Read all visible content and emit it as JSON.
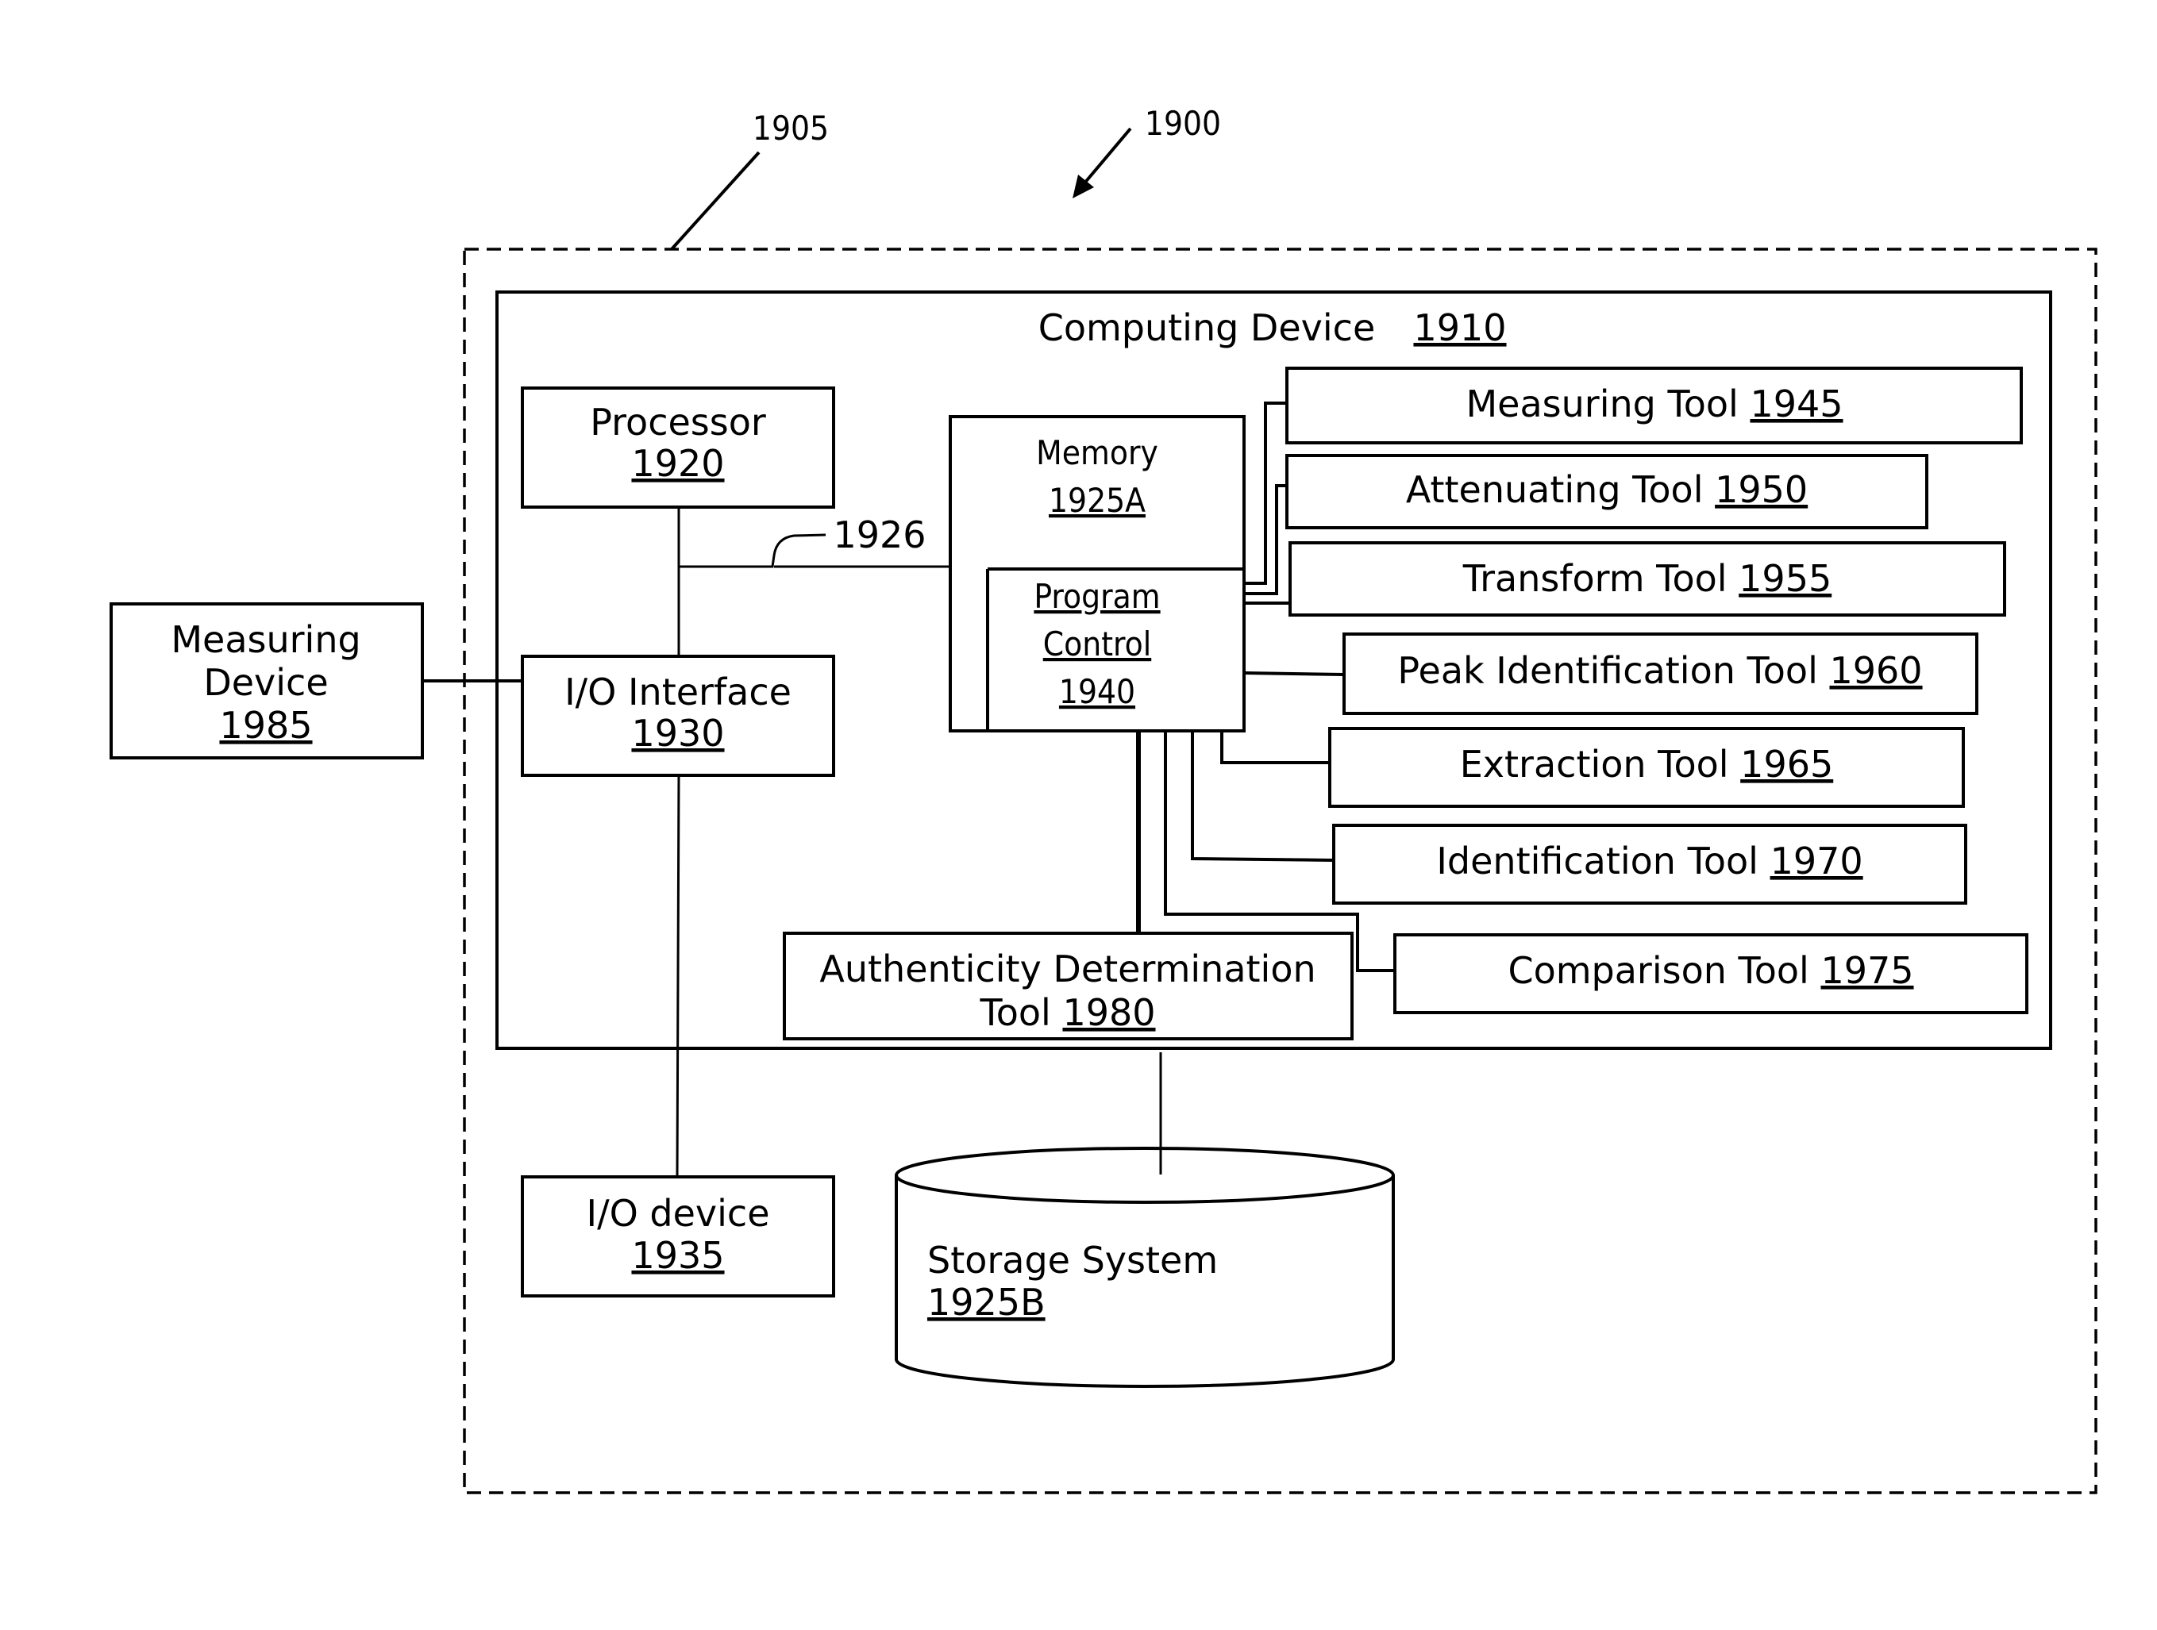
{
  "figure": {
    "system_ref": "1900",
    "environment_ref": "1905",
    "bus_ref": "1926"
  },
  "computing_device": {
    "label": "Computing Device",
    "ref": "1910"
  },
  "processor": {
    "label": "Processor",
    "ref": "1920"
  },
  "memory": {
    "label": "Memory",
    "ref": "1925A"
  },
  "program_control": {
    "line1": "Program",
    "line2": "Control",
    "ref": "1940"
  },
  "io_interface": {
    "label": "I/O Interface",
    "ref": "1930"
  },
  "io_device": {
    "label": "I/O device",
    "ref": "1935"
  },
  "measuring_device": {
    "line1": "Measuring",
    "line2": "Device",
    "ref": "1985"
  },
  "storage": {
    "label": "Storage System",
    "ref": "1925B"
  },
  "authenticity": {
    "line1": "Authenticity Determination",
    "line2": "Tool",
    "ref": "1980"
  },
  "tools": [
    {
      "label": "Measuring Tool",
      "ref": "1945"
    },
    {
      "label": "Attenuating Tool",
      "ref": "1950"
    },
    {
      "label": "Transform Tool",
      "ref": "1955"
    },
    {
      "label": "Peak Identification Tool",
      "ref": "1960"
    },
    {
      "label": "Extraction Tool",
      "ref": "1965"
    },
    {
      "label": "Identification Tool",
      "ref": "1970"
    },
    {
      "label": "Comparison Tool",
      "ref": "1975"
    }
  ]
}
